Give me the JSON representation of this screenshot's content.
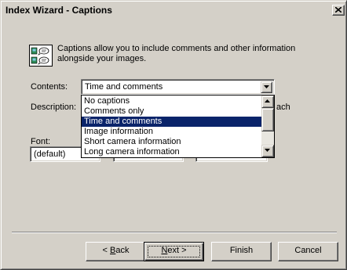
{
  "window": {
    "title": "Index Wizard - Captions"
  },
  "intro": {
    "icon": "captions-icon",
    "line1": "Captions allow you to include comments and other information",
    "line2": "alongside your images."
  },
  "contents": {
    "label": "Contents:",
    "value": "Time and comments",
    "options": [
      "No captions",
      "Comments only",
      "Time and comments",
      "Image information",
      "Short camera information",
      "Long camera information"
    ],
    "selected_index": 2
  },
  "description": {
    "label": "Description:",
    "trailing_text": "ach"
  },
  "font": {
    "label": "Font:",
    "family_value": "(default)"
  },
  "buttons": {
    "back": {
      "prefix": "< ",
      "mnemonic": "B",
      "rest": "ack"
    },
    "next": {
      "mnemonic": "N",
      "rest": "ext >"
    },
    "finish": "Finish",
    "cancel": "Cancel"
  },
  "colors": {
    "face": "#d4d0c8",
    "selection": "#0a246a",
    "selection_text": "#ffffff"
  }
}
